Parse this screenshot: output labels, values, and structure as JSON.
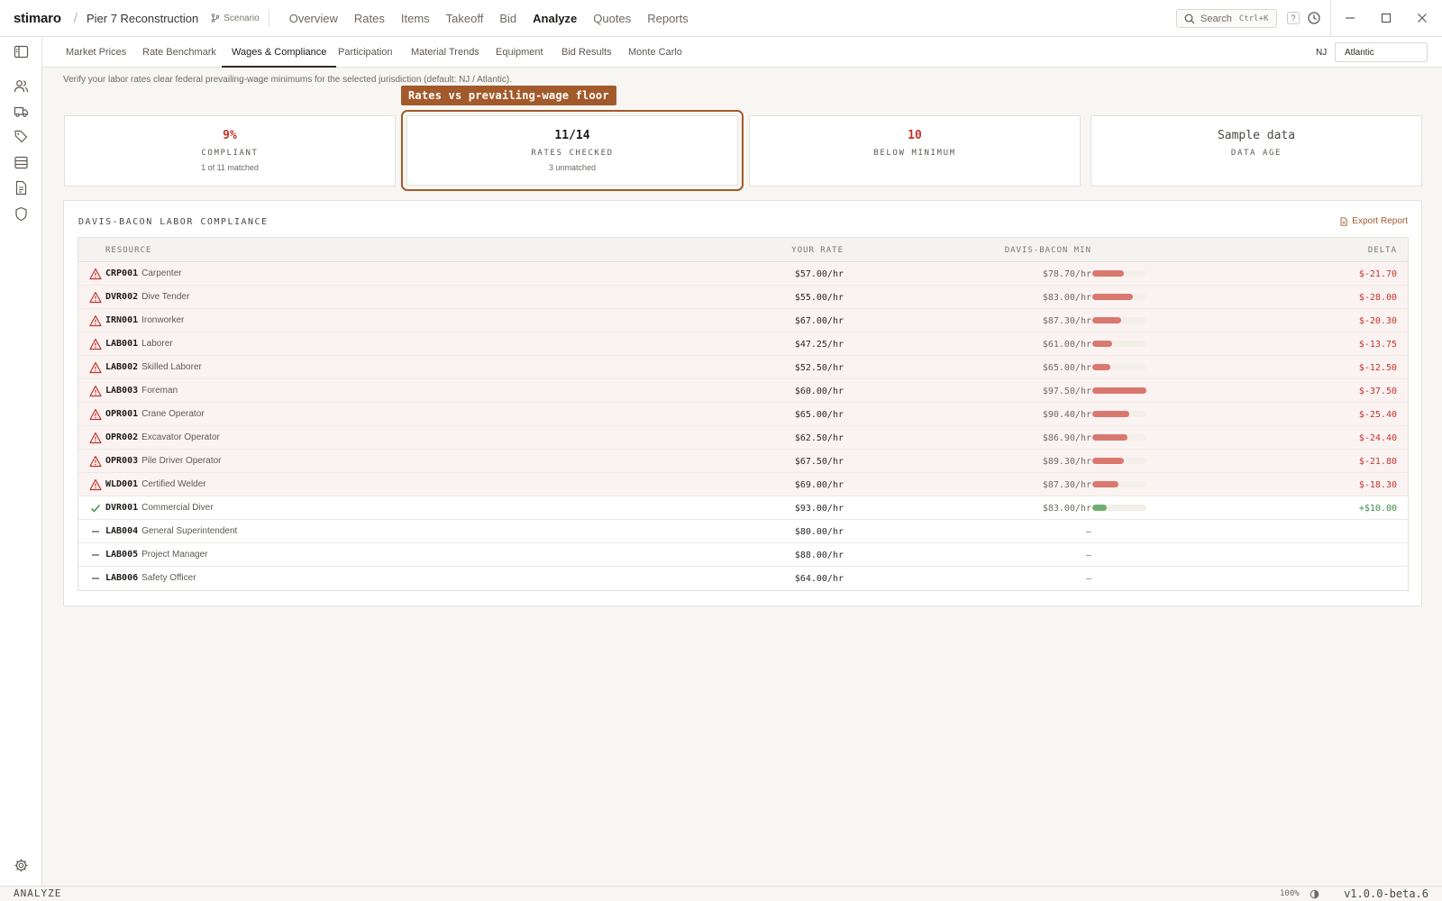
{
  "app": {
    "brand": "stimaro",
    "project": "Pier 7 Reconstruction",
    "scenario_label": "Scenario"
  },
  "nav": {
    "items": [
      "Overview",
      "Rates",
      "Items",
      "Takeoff",
      "Bid",
      "Analyze",
      "Quotes",
      "Reports"
    ],
    "active": "Analyze"
  },
  "search": {
    "label": "Search",
    "shortcut": "Ctrl+K"
  },
  "help_label": "?",
  "subtabs": {
    "items": [
      "Market Prices",
      "Rate Benchmark",
      "Wages & Compliance",
      "Participation",
      "Material Trends",
      "Equipment",
      "Bid Results",
      "Monte Carlo"
    ],
    "active": "Wages & Compliance"
  },
  "jurisdiction": {
    "state": "NJ",
    "county": "Atlantic"
  },
  "intro": "Verify your labor rates clear federal prevailing-wage minimums for the selected jurisdiction (default: NJ / Atlantic).",
  "callout": "Rates vs prevailing-wage floor",
  "stats": [
    {
      "value": "9%",
      "label": "COMPLIANT",
      "sub": "1 of 11 matched"
    },
    {
      "value": "11/14",
      "label": "RATES CHECKED",
      "sub": "3 unmatched"
    },
    {
      "value": "10",
      "label": "BELOW MINIMUM",
      "sub": ""
    },
    {
      "value": "Sample data",
      "label": "DATA AGE",
      "sub": ""
    }
  ],
  "panel": {
    "title": "DAVIS-BACON LABOR COMPLIANCE",
    "export_label": "Export Report",
    "columns": [
      "RESOURCE",
      "YOUR RATE",
      "DAVIS-BACON MIN",
      "DELTA"
    ],
    "rows": [
      {
        "code": "CRP001",
        "name": "Carpenter",
        "rate": "$57.00/hr",
        "min": "$78.70/hr",
        "delta": "$-21.70",
        "status": "fail",
        "gap_pct": 58
      },
      {
        "code": "DVR002",
        "name": "Dive Tender",
        "rate": "$55.00/hr",
        "min": "$83.00/hr",
        "delta": "$-28.00",
        "status": "fail",
        "gap_pct": 75
      },
      {
        "code": "IRN001",
        "name": "Ironworker",
        "rate": "$67.00/hr",
        "min": "$87.30/hr",
        "delta": "$-20.30",
        "status": "fail",
        "gap_pct": 54
      },
      {
        "code": "LAB001",
        "name": "Laborer",
        "rate": "$47.25/hr",
        "min": "$61.00/hr",
        "delta": "$-13.75",
        "status": "fail",
        "gap_pct": 37
      },
      {
        "code": "LAB002",
        "name": "Skilled Laborer",
        "rate": "$52.50/hr",
        "min": "$65.00/hr",
        "delta": "$-12.50",
        "status": "fail",
        "gap_pct": 33
      },
      {
        "code": "LAB003",
        "name": "Foreman",
        "rate": "$60.00/hr",
        "min": "$97.50/hr",
        "delta": "$-37.50",
        "status": "fail",
        "gap_pct": 100
      },
      {
        "code": "OPR001",
        "name": "Crane Operator",
        "rate": "$65.00/hr",
        "min": "$90.40/hr",
        "delta": "$-25.40",
        "status": "fail",
        "gap_pct": 68
      },
      {
        "code": "OPR002",
        "name": "Excavator Operator",
        "rate": "$62.50/hr",
        "min": "$86.90/hr",
        "delta": "$-24.40",
        "status": "fail",
        "gap_pct": 65
      },
      {
        "code": "OPR003",
        "name": "Pile Driver Operator",
        "rate": "$67.50/hr",
        "min": "$89.30/hr",
        "delta": "$-21.80",
        "status": "fail",
        "gap_pct": 58
      },
      {
        "code": "WLD001",
        "name": "Certified Welder",
        "rate": "$69.00/hr",
        "min": "$87.30/hr",
        "delta": "$-18.30",
        "status": "fail",
        "gap_pct": 49
      },
      {
        "code": "DVR001",
        "name": "Commercial Diver",
        "rate": "$93.00/hr",
        "min": "$83.00/hr",
        "delta": "+$10.00",
        "status": "pass",
        "gap_pct": 27
      },
      {
        "code": "LAB004",
        "name": "General Superintendent",
        "rate": "$80.00/hr",
        "min": "—",
        "delta": "",
        "status": "none",
        "gap_pct": 0
      },
      {
        "code": "LAB005",
        "name": "Project Manager",
        "rate": "$88.00/hr",
        "min": "—",
        "delta": "",
        "status": "none",
        "gap_pct": 0
      },
      {
        "code": "LAB006",
        "name": "Safety Officer",
        "rate": "$64.00/hr",
        "min": "—",
        "delta": "",
        "status": "none",
        "gap_pct": 0
      }
    ]
  },
  "statusbar": {
    "mode": "ANALYZE",
    "zoom": "100%",
    "version": "v1.0.0-beta.6"
  },
  "colors": {
    "accent": "#a35a2b",
    "fail": "#c5322b",
    "fail_bar": "#d9786f",
    "pass": "#3d8a44",
    "pass_bar": "#6fae72"
  }
}
